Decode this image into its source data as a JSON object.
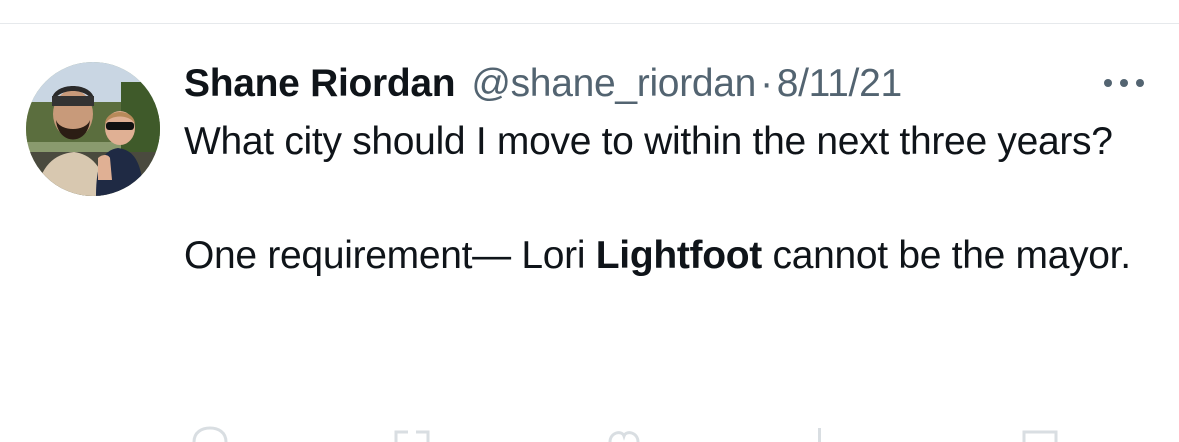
{
  "tweet": {
    "author_name": "Shane Riordan",
    "handle": "@shane_riordan",
    "separator": "·",
    "date": "8/11/21",
    "text_line1": "What city should I move to within the next three years?",
    "text_line2_before": "One requirement— Lori ",
    "text_line2_bold": "Lightfoot",
    "text_line2_after": " cannot be the mayor."
  },
  "icons": {
    "more": "more-horizontal-icon",
    "avatar": "avatar-photo",
    "reply": "reply-icon",
    "retweet": "retweet-icon",
    "like": "heart-icon",
    "views": "views-icon",
    "share": "share-icon"
  },
  "colors": {
    "text_primary": "#0f1419",
    "text_secondary": "#536471",
    "divider": "#e6e9ec",
    "background": "#ffffff"
  }
}
